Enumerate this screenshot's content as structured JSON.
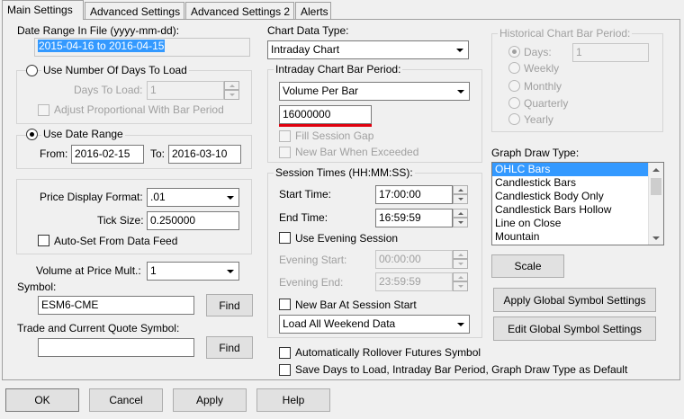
{
  "tabs": [
    "Main Settings",
    "Advanced Settings",
    "Advanced Settings 2",
    "Alerts"
  ],
  "date_range": {
    "label": "Date Range In File (yyyy-mm-dd):",
    "value": "2015-04-16 to 2016-04-15"
  },
  "days_to_load": {
    "radio_label": "Use Number Of Days To Load",
    "days_label": "Days To Load:",
    "days_value": "1",
    "adjust_label": "Adjust Proportional With Bar Period"
  },
  "date_range_group": {
    "radio_label": "Use Date Range",
    "from_label": "From:",
    "from_value": "2016-02-15",
    "to_label": "To:",
    "to_value": "2016-03-10"
  },
  "price_group": {
    "format_label": "Price Display Format:",
    "format_value": ".01",
    "tick_label": "Tick Size:",
    "tick_value": "0.250000",
    "autoset_label": "Auto-Set From Data Feed"
  },
  "volume_mult": {
    "label": "Volume at Price Mult.:",
    "value": "1"
  },
  "symbol": {
    "label": "Symbol:",
    "value": "ESM6-CME",
    "find": "Find"
  },
  "quote_symbol": {
    "label": "Trade and Current Quote Symbol:",
    "value": "",
    "find": "Find"
  },
  "chart_type": {
    "label": "Chart Data Type:",
    "value": "Intraday Chart"
  },
  "bar_period": {
    "title": "Intraday Chart Bar Period:",
    "type_value": "Volume Per Bar",
    "volume_value": "16000000",
    "fill_gap_label": "Fill Session Gap",
    "new_bar_label": "New Bar When Exceeded",
    "accent_color": "#e0000e"
  },
  "session": {
    "title": "Session Times (HH:MM:SS):",
    "start_label": "Start Time:",
    "start_value": "17:00:00",
    "end_label": "End Time:",
    "end_value": "16:59:59",
    "evening_check": "Use Evening Session",
    "evening_start_label": "Evening Start:",
    "evening_start_value": "00:00:00",
    "evening_end_label": "Evening End:",
    "evening_end_value": "23:59:59",
    "new_bar_label": "New Bar At Session Start",
    "weekend_value": "Load All Weekend Data"
  },
  "historical": {
    "title": "Historical Chart Bar Period:",
    "options": [
      "Days:",
      "Weekly",
      "Monthly",
      "Quarterly",
      "Yearly"
    ],
    "days_value": "1"
  },
  "graph_draw": {
    "label": "Graph Draw Type:",
    "items": [
      "OHLC Bars",
      "Candlestick Bars",
      "Candlestick Body Only",
      "Candlestick Bars Hollow",
      "Line on Close",
      "Mountain"
    ],
    "selected": "OHLC Bars"
  },
  "scale_button": "Scale",
  "apply_global": "Apply Global Symbol Settings",
  "edit_global": "Edit Global Symbol Settings",
  "rollover_label": "Automatically Rollover Futures Symbol",
  "save_default_label": "Save Days to Load, Intraday Bar Period, Graph Draw Type as Default",
  "footer": {
    "ok": "OK",
    "cancel": "Cancel",
    "apply": "Apply",
    "help": "Help"
  },
  "colors": {
    "selection": "#3399ff",
    "window_bg": "#f0f0f0"
  }
}
